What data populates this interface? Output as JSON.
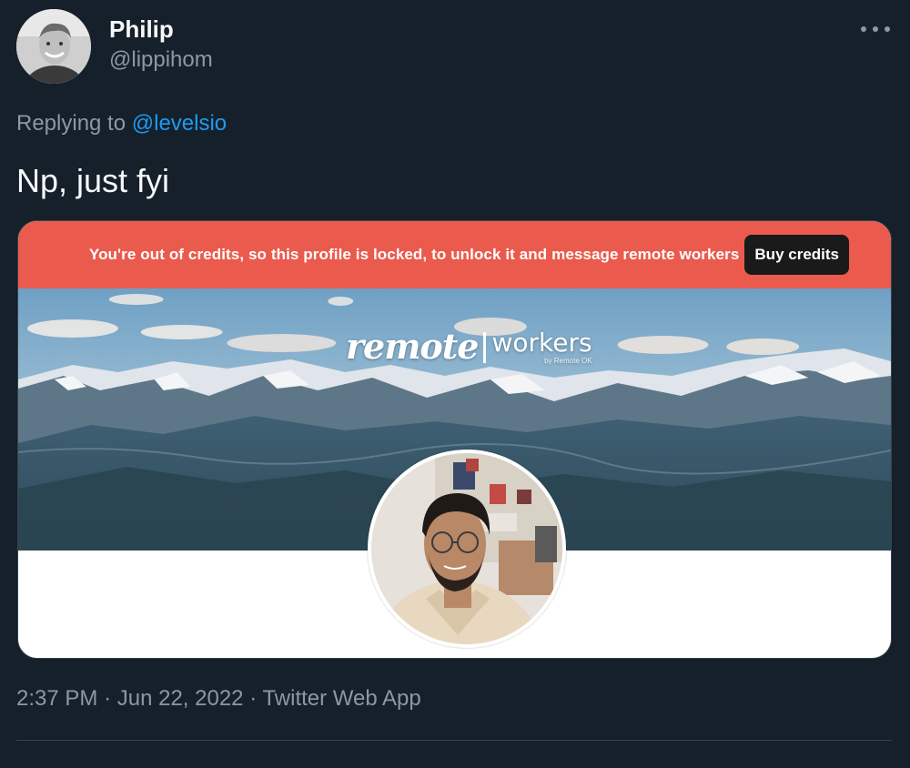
{
  "author": {
    "display_name": "Philip",
    "handle": "@lippihom"
  },
  "reply": {
    "prefix": "Replying to",
    "mention": "@levelsio"
  },
  "tweet": {
    "text": "Np, just fyi"
  },
  "media": {
    "banner_text": "You're out of credits, so this profile is locked, to unlock it and message remote workers",
    "buy_button_label": "Buy credits",
    "logo_script": "remote",
    "logo_word": "workers",
    "logo_byline": "by Remote OK"
  },
  "meta": {
    "time": "2:37 PM",
    "separator": "·",
    "date": "Jun 22, 2022",
    "source": "Twitter Web App"
  },
  "icons": {
    "more": "more-horizontal-icon"
  },
  "colors": {
    "background": "#15202b",
    "accent": "#1d9bf0",
    "secondary_text": "#8b98a5",
    "banner": "#ea5b4d",
    "button": "#1a1a1a"
  }
}
